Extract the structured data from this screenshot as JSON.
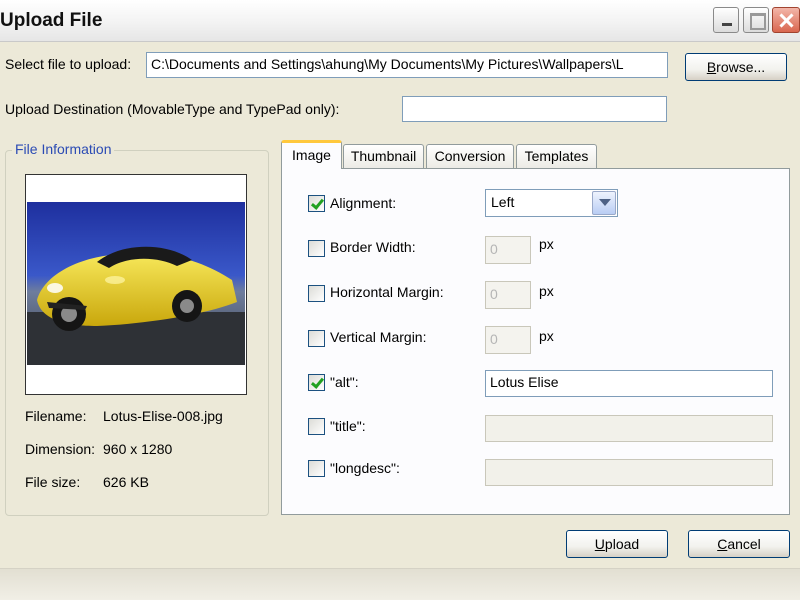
{
  "window": {
    "title": "Upload File"
  },
  "file_select": {
    "label": "Select file to upload:",
    "value": "C:\\Documents and Settings\\ahung\\My Documents\\My Pictures\\Wallpapers\\L",
    "browse_label_underlined": "B",
    "browse_label_rest": "rowse..."
  },
  "destination": {
    "label": "Upload Destination (MovableType and TypePad only):",
    "value": ""
  },
  "file_info": {
    "legend": "File Information",
    "filename_label": "Filename:",
    "filename_value": "Lotus-Elise-008.jpg",
    "dimension_label": "Dimension:",
    "dimension_value": "960 x 1280",
    "filesize_label": "File size:",
    "filesize_value": "626 KB"
  },
  "tabs": [
    "Image",
    "Thumbnail",
    "Conversion",
    "Templates"
  ],
  "image_tab": {
    "alignment": {
      "label": "Alignment:",
      "checked": true,
      "value": "Left"
    },
    "border_width": {
      "label": "Border Width:",
      "checked": false,
      "value": "0",
      "unit": "px"
    },
    "horizontal_margin": {
      "label": "Horizontal Margin:",
      "checked": false,
      "value": "0",
      "unit": "px"
    },
    "vertical_margin": {
      "label": "Vertical Margin:",
      "checked": false,
      "value": "0",
      "unit": "px"
    },
    "alt": {
      "label": "\"alt\":",
      "checked": true,
      "value": "Lotus Elise"
    },
    "title": {
      "label": "\"title\":",
      "checked": false,
      "value": ""
    },
    "longdesc": {
      "label": "\"longdesc\":",
      "checked": false,
      "value": ""
    }
  },
  "actions": {
    "upload_underlined": "U",
    "upload_rest": "pload",
    "cancel_underlined": "C",
    "cancel_rest": "ancel"
  },
  "colors": {
    "dialog_bg": "#ece9d8",
    "group_legend": "#2b4bb4",
    "active_tab_accent": "#ffc83c",
    "check_mark": "#21a121"
  }
}
